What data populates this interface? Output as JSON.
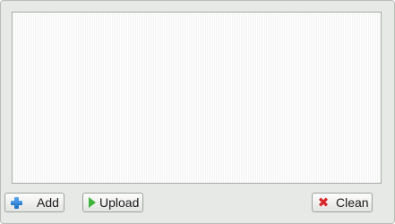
{
  "uploader": {
    "file_list": [],
    "buttons": {
      "add": {
        "label": "Add",
        "icon": "plus-icon"
      },
      "upload": {
        "label": "Upload",
        "icon": "play-icon"
      },
      "clean": {
        "label": "Clean",
        "icon": "x-icon"
      }
    }
  },
  "colors": {
    "panel_background": "#e6e9e5",
    "add_icon": "#1e6fc6",
    "upload_icon": "#3eb33b",
    "clean_icon": "#d9262b"
  }
}
